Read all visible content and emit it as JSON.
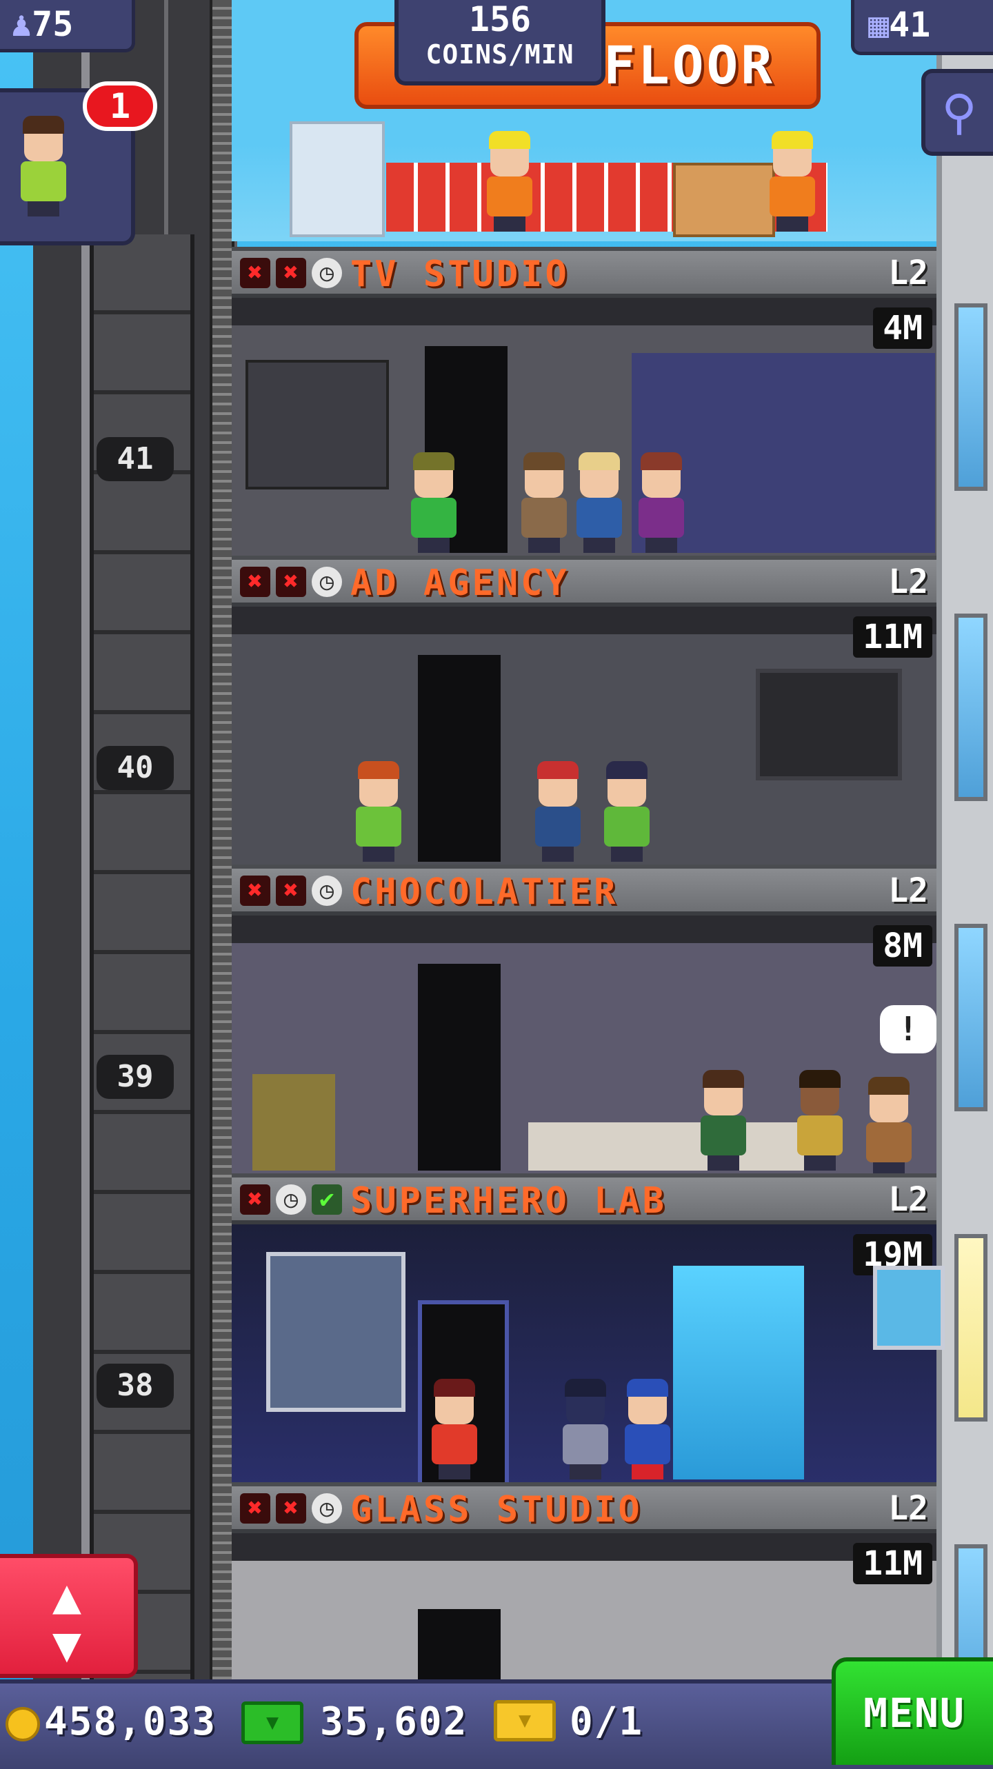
{
  "hud": {
    "population": "75",
    "coins_per_min_value": "156",
    "coins_per_min_label": "COINS/MIN",
    "floor_count": "41",
    "notification_badge": "1",
    "construction_banner": "FLOOR"
  },
  "elevator": {
    "floor_numbers": [
      "41",
      "40",
      "39",
      "38"
    ]
  },
  "floors": [
    {
      "name": "TV STUDIO",
      "level": "L2",
      "stock": "4M",
      "icons": [
        "x",
        "x",
        "clock"
      ]
    },
    {
      "name": "AD AGENCY",
      "level": "L2",
      "stock": "11M",
      "icons": [
        "x",
        "x",
        "clock"
      ]
    },
    {
      "name": "CHOCOLATIER",
      "level": "L2",
      "stock": "8M",
      "icons": [
        "x",
        "x",
        "clock"
      ]
    },
    {
      "name": "SUPERHERO LAB",
      "level": "L2",
      "stock": "19M",
      "icons": [
        "x",
        "clock",
        "check"
      ]
    },
    {
      "name": "GLASS STUDIO",
      "level": "L2",
      "stock": "11M",
      "icons": [
        "x",
        "x",
        "clock"
      ]
    }
  ],
  "bottom_bar": {
    "coins": "458,033",
    "tower_bux": "35,602",
    "tickets": "0/1",
    "menu_label": "MENU"
  },
  "colors": {
    "floor_name": "#ff6a2a",
    "hud_panel": "#3e4270",
    "menu_button": "#14a014",
    "elevator_button": "#e2203d",
    "badge": "#e8171f"
  }
}
